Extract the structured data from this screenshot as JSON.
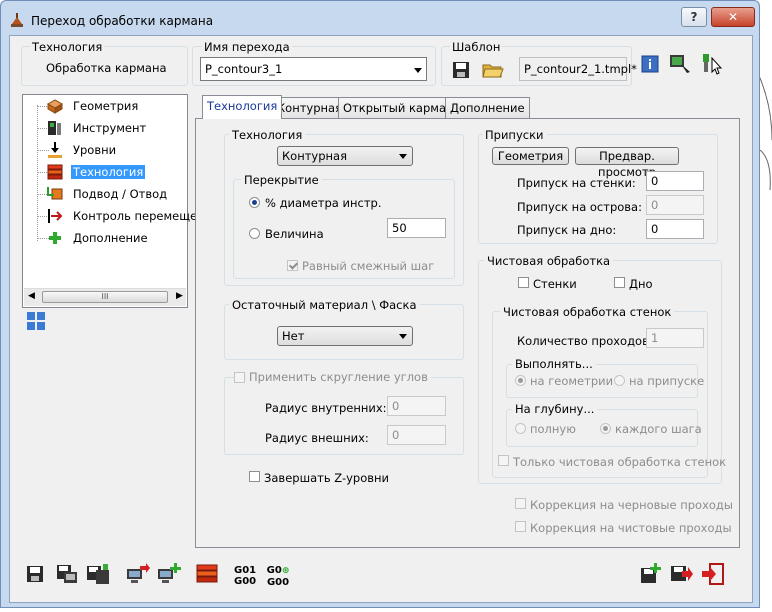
{
  "window": {
    "title": "Переход обработки кармана"
  },
  "titlebar_buttons": {
    "help": "?",
    "close": "✕"
  },
  "technology": {
    "label": "Технология",
    "value": "Обработка кармана"
  },
  "operation_name": {
    "label": "Имя перехода",
    "value": "P_contour3_1"
  },
  "template": {
    "label": "Шаблон",
    "value": "P_contour2_1.tmpl*"
  },
  "tree": {
    "items": [
      {
        "label": "Геометрия",
        "icon": "geometry-icon"
      },
      {
        "label": "Инструмент",
        "icon": "tool-icon"
      },
      {
        "label": "Уровни",
        "icon": "levels-icon"
      },
      {
        "label": "Технология",
        "icon": "technology-icon",
        "selected": true
      },
      {
        "label": "Подвод / Отвод",
        "icon": "lead-in-out-icon"
      },
      {
        "label": "Контроль перемеще",
        "icon": "motion-control-icon"
      },
      {
        "label": "Дополнение",
        "icon": "plus-icon"
      }
    ],
    "scroll_grip": "III"
  },
  "tabs": [
    "Технология",
    "Контурная",
    "Открытый карман",
    "Дополнение"
  ],
  "tech_group": {
    "title": "Технология",
    "strategy": "Контурная",
    "overlap": {
      "title": "Перекрытие",
      "pct_label": "% диаметра инстр.",
      "value_label": "Величина",
      "value": "50",
      "equal_step_label": "Равный смежный шаг"
    }
  },
  "remaining": {
    "title": "Остаточный материал \\ Фаска",
    "value": "Нет"
  },
  "corner": {
    "title": "Применить скругление углов",
    "inner_label": "Радиус внутренних:",
    "inner_value": "0",
    "outer_label": "Радиус внешних:",
    "outer_value": "0"
  },
  "finish_z_label": "Завершать Z-уровни",
  "allowances": {
    "title": "Припуски",
    "geometry_btn": "Геометрия",
    "preview_btn": "Предвар. просмотр",
    "walls_label": "Припуск на стенки:",
    "walls_value": "0",
    "islands_label": "Припуск на острова:",
    "islands_value": "0",
    "floor_label": "Припуск на дно:",
    "floor_value": "0"
  },
  "finish": {
    "title": "Чистовая обработка",
    "walls_label": "Стенки",
    "floor_label": "Дно",
    "wall_finish": {
      "title": "Чистовая обработка стенок",
      "passes_label": "Количество проходов:",
      "passes_value": "1",
      "perform": {
        "title": "Выполнять...",
        "opt1": "на геометрии",
        "opt2": "на припуске"
      },
      "depth": {
        "title": "На глубину...",
        "opt1": "полную",
        "opt2": "каждого шага"
      },
      "only_label": "Только чистовая обработка стенок"
    }
  },
  "corrections": {
    "rough_label": "Коррекция на черновые проходы",
    "finish_label": "Коррекция на чистовые проходы"
  },
  "bottom_toolbar": {
    "g01_1": "G01",
    "g00_1": "G00",
    "g0_2": "G0",
    "g00_2": "G00"
  }
}
